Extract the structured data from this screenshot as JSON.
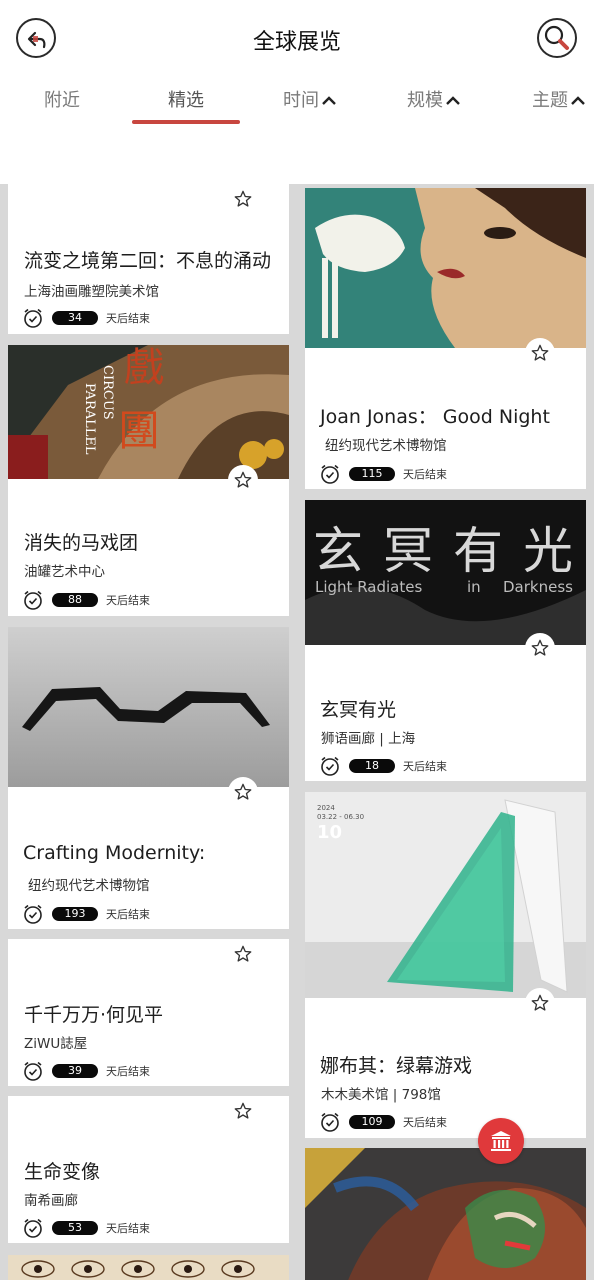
{
  "header": {
    "title": "全球展览",
    "back_icon": "back-arrow-icon",
    "search_icon": "search-icon"
  },
  "tabs": [
    {
      "label": "附近",
      "active": false,
      "has_chevron": false
    },
    {
      "label": "精选",
      "active": true,
      "has_chevron": false
    },
    {
      "label": "时间",
      "active": false,
      "has_chevron": true
    },
    {
      "label": "规模",
      "active": false,
      "has_chevron": true
    },
    {
      "label": "主题",
      "active": false,
      "has_chevron": true
    }
  ],
  "days_suffix": "天后结束",
  "accent_color": "#c8463f",
  "fab_color": "#e0393b",
  "cards": {
    "left": [
      {
        "title": "流变之境第二回：不息的涌动",
        "venue": "上海油画雕塑院美术馆",
        "days": "34"
      },
      {
        "title": "消失的马戏团",
        "venue": "油罐艺术中心",
        "days": "88",
        "image_text": [
          "PARALLEL",
          "CIRCUS",
          "戲",
          "團"
        ]
      },
      {
        "title": "Crafting Modernity:",
        "venue": "纽约现代艺术博物馆",
        "days": "193"
      },
      {
        "title": "千千万万·何见平",
        "venue": "ZiWU誌屋",
        "days": "39"
      },
      {
        "title": "生命变像",
        "venue": "南希画廊",
        "days": "53"
      }
    ],
    "right": [
      {
        "title": "Joan Jonas： Good Night",
        "venue": "纽约现代艺术博物馆",
        "days": "115"
      },
      {
        "title": "玄冥有光",
        "venue": "狮语画廊 | 上海",
        "days": "18",
        "image_text": [
          "玄",
          "冥",
          "有",
          "光",
          "Light Radiates",
          "in",
          "Darkness"
        ]
      },
      {
        "title": "娜布其：绿幕游戏",
        "venue": "木木美术馆 | 798馆",
        "days": "109",
        "image_text": [
          "2024",
          "03.22 - 06.30",
          "10"
        ]
      },
      {
        "title": "",
        "venue": "",
        "days": ""
      }
    ]
  }
}
